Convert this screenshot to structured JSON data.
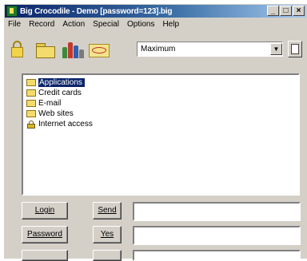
{
  "window": {
    "title": "Big Crocodile - Demo [password=123].big",
    "controls": {
      "minimize": "_",
      "maximize": "□",
      "close": "×"
    }
  },
  "menu": [
    "File",
    "Record",
    "Action",
    "Special",
    "Options",
    "Help"
  ],
  "toolbar": {
    "icons": [
      "lock-icon",
      "folder-icon",
      "bottles-icon",
      "envelope-icon"
    ],
    "view_select": {
      "value": "Maximum",
      "arrow": "▼"
    }
  },
  "tree": {
    "items": [
      {
        "label": "Applications",
        "icon": "folder",
        "selected": true
      },
      {
        "label": "Credit cards",
        "icon": "folder"
      },
      {
        "label": "E-mail",
        "icon": "folder"
      },
      {
        "label": "Web sites",
        "icon": "folder"
      },
      {
        "label": "Internet access",
        "icon": "lock"
      }
    ]
  },
  "actions": {
    "login": "Login",
    "send": "Send",
    "password": "Password",
    "yes": "Yes"
  },
  "colors": {
    "selection": "#0a246a",
    "title_start": "#0a246a",
    "title_end": "#a6caf0",
    "face": "#d4d0c8"
  }
}
